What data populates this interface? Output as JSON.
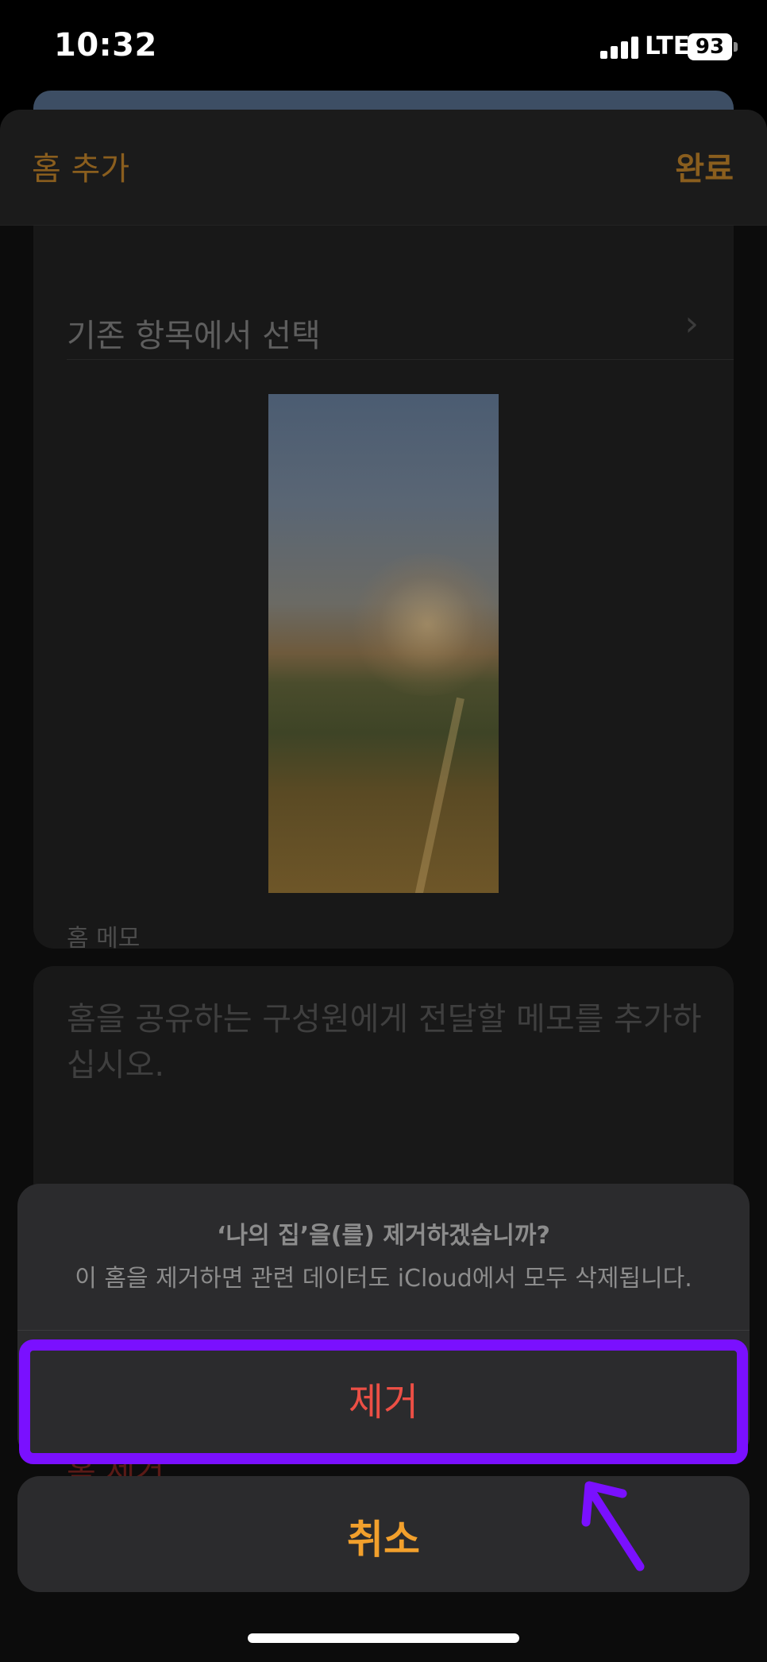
{
  "status_bar": {
    "time": "10:32",
    "network": "LTE",
    "battery": "93"
  },
  "nav": {
    "title": "홈 추가",
    "done_label": "완료"
  },
  "wallpaper_section": {
    "choose_label": "기존 항목에서 선택"
  },
  "memo": {
    "section_label": "홈 메모",
    "placeholder": "홈을 공유하는 구성원에게 전달할 메모를 추가하십시오."
  },
  "remove_home_label": "홈 제거",
  "action_sheet": {
    "title": "‘나의 집’을(를) 제거하겠습니까?",
    "message": "이 홈을 제거하면 관련 데이터도 iCloud에서 모두 삭제됩니다.",
    "remove_label": "제거",
    "cancel_label": "취소"
  },
  "colors": {
    "accent": "#f2a02c",
    "destructive": "#ec4f45",
    "highlight": "#7a10ff"
  }
}
